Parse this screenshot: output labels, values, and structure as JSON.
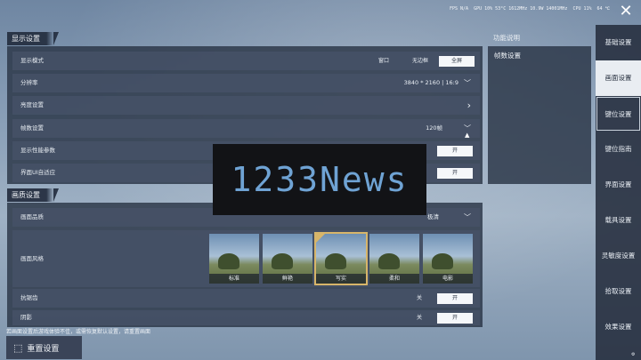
{
  "status_bar": {
    "fps": "FPS N/A",
    "gpu": "GPU 10% 53°C 1612MHz 10.9W 14001MHz",
    "cpu": "CPU 11%",
    "extra": "64 ℃"
  },
  "display_section": {
    "title": "显示设置",
    "display_mode": {
      "label": "显示模式",
      "options": [
        "窗口",
        "无边框",
        "全屏"
      ],
      "selected": "全屏"
    },
    "resolution": {
      "label": "分辨率",
      "value": "3840 * 2160 | 16:9"
    },
    "brightness": {
      "label": "亮度设置"
    },
    "framerate": {
      "label": "帧数设置",
      "value": "120帧"
    },
    "perf_params": {
      "label": "显示性能参数",
      "toggle": "开"
    },
    "ui_adapt": {
      "label": "界面UI自适应",
      "toggle": "开"
    }
  },
  "quality_section": {
    "title": "画质设置",
    "quality": {
      "label": "画面品质",
      "value": "极清"
    },
    "style": {
      "label": "画面风格",
      "options": [
        "标准",
        "鲜艳",
        "写实",
        "柔和",
        "电影"
      ],
      "selected": "写实"
    },
    "antialias": {
      "label": "抗锯齿",
      "off": "关",
      "on": "开",
      "state": "开"
    },
    "shadow": {
      "label": "阴影",
      "off": "关",
      "on": "开",
      "state": "开"
    }
  },
  "info": {
    "title": "功能说明",
    "topic": "帧数设置"
  },
  "nav": {
    "items": [
      "基础设置",
      "画面设置",
      "键位设置",
      "键位指南",
      "界面设置",
      "载具设置",
      "灵敏度设置",
      "拾取设置",
      "效果设置"
    ],
    "active": "画面设置",
    "highlighted": "键位设置"
  },
  "footer": {
    "note": "若画面设置后游戏体验不佳，或需恢复默认设置，请重置画面",
    "reset_label": "重置设置"
  },
  "watermark": {
    "text": "1233News"
  },
  "close_icon": "close-icon",
  "colors": {
    "panel": "#2a3446",
    "selected": "#f5f7fa",
    "accent": "#d7b56a"
  }
}
